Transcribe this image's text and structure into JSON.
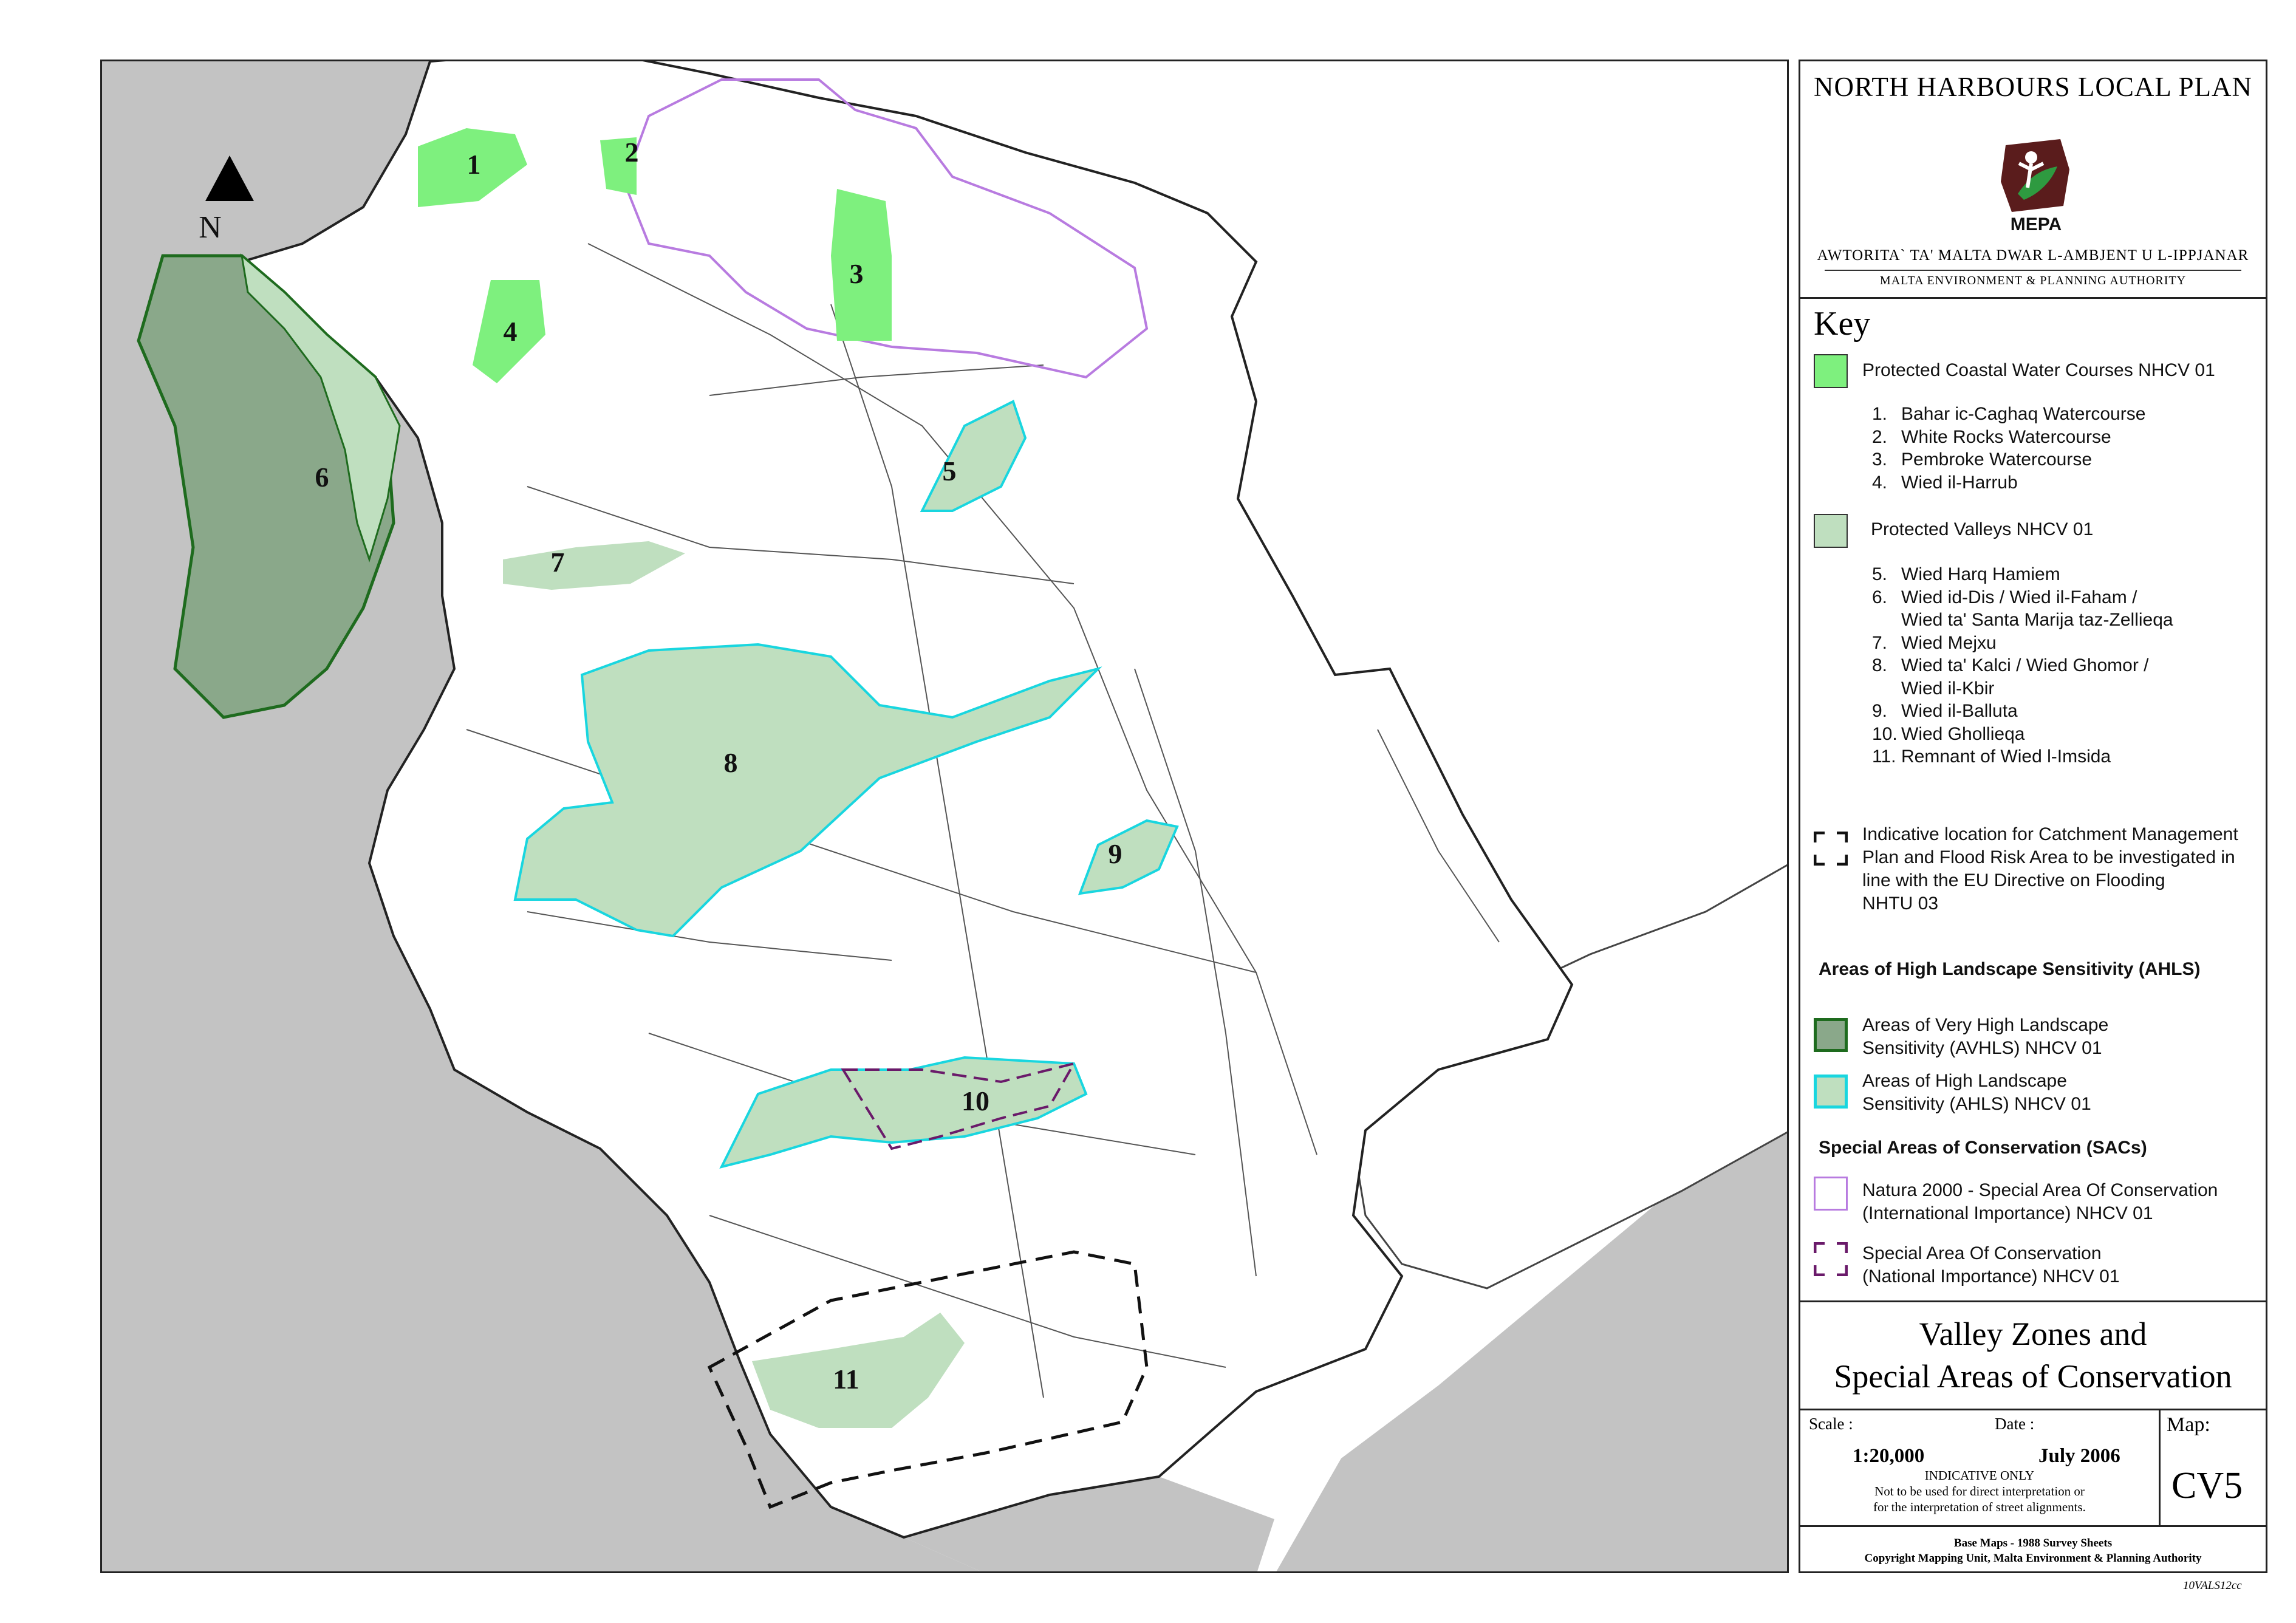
{
  "map": {
    "north_label": "N",
    "zone_labels": [
      "1",
      "2",
      "3",
      "4",
      "5",
      "6",
      "7",
      "8",
      "9",
      "10",
      "11"
    ],
    "colors": {
      "coastal": "#7ef07e",
      "valley": "#bfdfbf",
      "avhls_fill": "#8aa88a",
      "avhls_stroke": "#1e6b1e",
      "ahls_stroke": "#19d6df",
      "natura": "#b87be0",
      "sac_national": "#6a1a6a",
      "developed": "#c3c3c3",
      "roads": "#555555"
    }
  },
  "title": {
    "plan": "NORTH HARBOURS LOCAL PLAN",
    "logo_text": "MEPA",
    "authority_mt": "AWTORITA` TA' MALTA DWAR L-AMBJENT U L-IPPJANAR",
    "authority_en": "MALTA ENVIRONMENT & PLANNING AUTHORITY"
  },
  "key": {
    "title": "Key",
    "coastal_label": "Protected Coastal Water Courses NHCV 01",
    "coastal_items": [
      {
        "n": "1.",
        "name": "Bahar ic-Caghaq Watercourse"
      },
      {
        "n": "2.",
        "name": "White Rocks Watercourse"
      },
      {
        "n": "3.",
        "name": "Pembroke Watercourse"
      },
      {
        "n": "4.",
        "name": "Wied il-Harrub"
      }
    ],
    "valleys_label": "Protected Valleys NHCV 01",
    "valley_items": [
      {
        "n": "5.",
        "name": "Wied Harq Hamiem"
      },
      {
        "n": "6.",
        "name": "Wied id-Dis / Wied il-Faham /"
      },
      {
        "n": "",
        "name": "Wied ta' Santa Marija taz-Zellieqa"
      },
      {
        "n": "7.",
        "name": "Wied Mejxu"
      },
      {
        "n": "8.",
        "name": "Wied ta' Kalci / Wied Ghomor /"
      },
      {
        "n": "",
        "name": "Wied il-Kbir"
      },
      {
        "n": "9.",
        "name": "Wied il-Balluta"
      },
      {
        "n": "10.",
        "name": "Wied Ghollieqa"
      },
      {
        "n": "11.",
        "name": "Remnant of Wied l-Imsida"
      }
    ],
    "catchment_lines": [
      "Indicative location for Catchment Management",
      "Plan and Flood Risk Area to be investigated in",
      "line with the EU Directive on Flooding",
      "NHTU 03"
    ],
    "ahls_heading": "Areas of High Landscape Sensitivity (AHLS)",
    "avhls_lines": [
      "Areas of Very High Landscape",
      "Sensitivity (AVHLS) NHCV 01"
    ],
    "ahls_lines": [
      "Areas of High Landscape",
      "Sensitivity (AHLS) NHCV 01"
    ],
    "sac_heading": "Special Areas of Conservation (SACs)",
    "natura_lines": [
      "Natura 2000 - Special Area Of Conservation",
      "(International Importance) NHCV 01"
    ],
    "sac_national_lines": [
      "Special Area Of Conservation",
      "(National Importance) NHCV 01"
    ]
  },
  "title_block": {
    "line1": "Valley Zones and",
    "line2": "Special Areas of Conservation",
    "scale_label": "Scale :",
    "scale_value": "1:20,000",
    "date_label": "Date :",
    "date_value": "July 2006",
    "map_label": "Map:",
    "map_id": "CV5",
    "indicative": "INDICATIVE ONLY",
    "note1": "Not to be used for direct interpretation or",
    "note2": "for the interpretation of street alignments.",
    "base_maps": "Base Maps - 1988 Survey Sheets",
    "copyright": "Copyright Mapping Unit, Malta Environment & Planning Authority"
  },
  "ref_code": "10VALS12cc"
}
